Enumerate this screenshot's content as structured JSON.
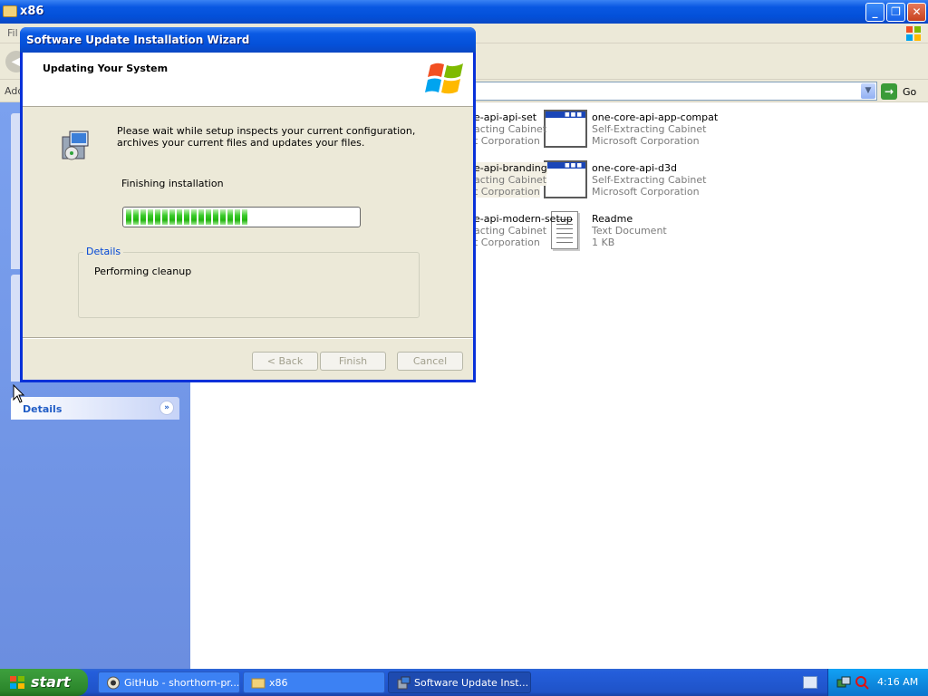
{
  "explorer": {
    "title": "x86",
    "menu_partial": "Fil",
    "address_label_partial": "Add",
    "go_label": "Go",
    "details_label": "Details",
    "files": [
      {
        "name": "e-api-api-set",
        "type": "acting Cabinet",
        "publisher": "t Corporation",
        "icon": "cabinet-icon",
        "selected": false
      },
      {
        "name": "one-core-api-app-compat",
        "type": "Self-Extracting Cabinet",
        "publisher": "Microsoft Corporation",
        "icon": "cabinet-icon",
        "selected": false
      },
      {
        "name": "e-api-branding",
        "type": "acting Cabinet",
        "publisher": "t Corporation",
        "icon": "cabinet-icon",
        "selected": true
      },
      {
        "name": "one-core-api-d3d",
        "type": "Self-Extracting Cabinet",
        "publisher": "Microsoft Corporation",
        "icon": "cabinet-icon",
        "selected": false
      },
      {
        "name": "e-api-modern-setup",
        "type": "acting Cabinet",
        "publisher": "t Corporation",
        "icon": "cabinet-icon",
        "selected": false
      },
      {
        "name": "Readme",
        "type": "Text Document",
        "publisher": "1 KB",
        "icon": "text-document-icon",
        "selected": false
      }
    ]
  },
  "wizard": {
    "title": "Software Update Installation Wizard",
    "header": "Updating Your System",
    "message": "Please wait while setup inspects your current configuration, archives your current files and updates your files.",
    "status": "Finishing installation",
    "progress_percent": 52,
    "details_legend": "Details",
    "details_text": "Performing cleanup",
    "buttons": {
      "back": "< Back",
      "finish": "Finish",
      "cancel": "Cancel"
    }
  },
  "taskbar": {
    "start_label": "start",
    "tasks": [
      {
        "label": "GitHub - shorthorn-pr...",
        "icon": "browser-icon",
        "active": false
      },
      {
        "label": "x86",
        "icon": "folder-icon",
        "active": false
      },
      {
        "label": "Software Update Inst...",
        "icon": "setup-icon",
        "active": true
      }
    ],
    "clock": "4:16 AM"
  },
  "colors": {
    "title_blue": "#0a5ae4",
    "taskbar_blue": "#245edb",
    "start_green": "#3a9a3a",
    "progress_green": "#22b40f",
    "dialog_face": "#ece9d8"
  }
}
